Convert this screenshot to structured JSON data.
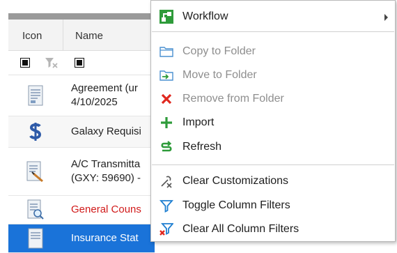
{
  "grid": {
    "columns": {
      "icon": "Icon",
      "name": "Name"
    },
    "rows": [
      {
        "name_line1": "Agreement (ur",
        "name_line2": "4/10/2025",
        "icon": "document-icon",
        "style": "normal"
      },
      {
        "name_line1": "Galaxy Requisi",
        "name_line2": "",
        "icon": "dollar-icon",
        "style": "alt"
      },
      {
        "name_line1": "A/C Transmitta",
        "name_line2": "(GXY: 59690) -",
        "icon": "document-pen-icon",
        "style": "normal"
      },
      {
        "name_line1": "General Couns",
        "name_line2": "",
        "icon": "document-search-icon",
        "style": "red"
      },
      {
        "name_line1": "Insurance Stat",
        "name_line2": "",
        "icon": "document-icon",
        "style": "selected"
      }
    ]
  },
  "menu": {
    "items": [
      {
        "label": "Workflow",
        "icon": "workflow-icon",
        "disabled": false,
        "submenu": true
      },
      {
        "label": "Copy to Folder",
        "icon": "copy-folder-icon",
        "disabled": true
      },
      {
        "label": "Move to Folder",
        "icon": "move-folder-icon",
        "disabled": true
      },
      {
        "label": "Remove from Folder",
        "icon": "remove-x-icon",
        "disabled": true
      },
      {
        "label": "Import",
        "icon": "plus-icon",
        "disabled": false
      },
      {
        "label": "Refresh",
        "icon": "refresh-icon",
        "disabled": false
      },
      {
        "label": "Clear Customizations",
        "icon": "clear-customizations-icon",
        "disabled": false
      },
      {
        "label": "Toggle Column Filters",
        "icon": "filter-icon",
        "disabled": false
      },
      {
        "label": "Clear All Column Filters",
        "icon": "clear-filter-icon",
        "disabled": false
      }
    ]
  },
  "colors": {
    "selection": "#1a73d9",
    "red_text": "#d11a1a",
    "green_icon": "#2e9b3a",
    "blue_icon": "#1f7fd1",
    "disabled_text": "#8e8e8e"
  }
}
